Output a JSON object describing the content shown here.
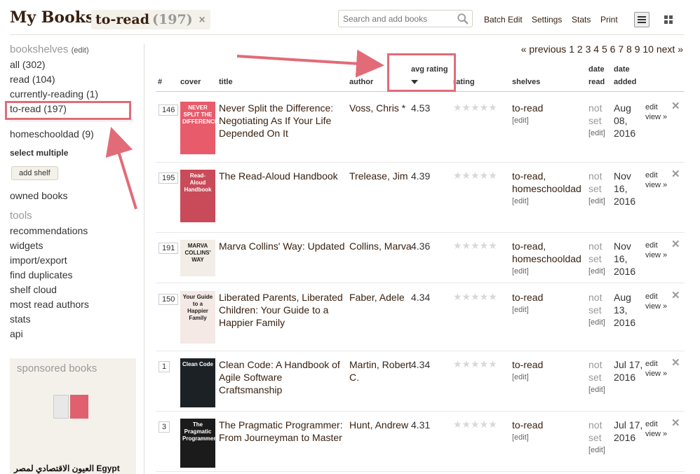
{
  "header": {
    "title": "My Books:",
    "shelf_name": "to-read",
    "shelf_count": "(197)",
    "remove_label": "×",
    "search_placeholder": "Search and add books",
    "links": [
      "Batch Edit",
      "Settings",
      "Stats",
      "Print"
    ]
  },
  "sidebar": {
    "bookshelves_heading": "bookshelves",
    "edit_link": "(edit)",
    "shelves": [
      "all (302)",
      "read (104)",
      "currently-reading (1)",
      "to-read (197)"
    ],
    "custom_shelves": [
      "homeschooldad (9)"
    ],
    "select_multiple": "select multiple",
    "add_shelf": "add shelf",
    "owned_books": "owned books",
    "tools_heading": "tools",
    "tools": [
      "recommendations",
      "widgets",
      "import/export",
      "find duplicates",
      "shelf cloud",
      "most read authors",
      "stats",
      "api"
    ],
    "sponsored_heading": "sponsored books",
    "sponsored_text": "العيون الاقتصادي لمصر Egypt"
  },
  "pagination": {
    "previous": "« previous",
    "pages": [
      "1",
      "2",
      "3",
      "4",
      "5",
      "6",
      "7",
      "8",
      "9",
      "10"
    ],
    "next": "next »"
  },
  "columns": {
    "num": "#",
    "cover": "cover",
    "title": "title",
    "author": "author",
    "avg_rating": "avg rating",
    "rating": "rating",
    "shelves": "shelves",
    "date_read_1": "date",
    "date_read_2": "read",
    "date_added_1": "date",
    "date_added_2": "added"
  },
  "row_labels": {
    "edit": "[edit]",
    "not": "not",
    "set": "set",
    "action_edit": "edit",
    "action_view": "view »",
    "delete": "✕",
    "stars": "★★★★★"
  },
  "books": [
    {
      "num": "146",
      "title": "Never Split the Difference: Negotiating As If Your Life Depended On It",
      "author": "Voss, Chris *",
      "avg": "4.53",
      "shelves": "to-read",
      "shelves2": "",
      "added1": "Aug",
      "added2": "08,",
      "added3": "2016",
      "cover_bg": "#e85b6b",
      "cover_text": "NEVER SPLIT THE DIFFERENCE"
    },
    {
      "num": "195",
      "title": "The Read-Aloud Handbook",
      "author": "Trelease, Jim",
      "avg": "4.39",
      "shelves": "to-read,",
      "shelves2": "homeschooldad",
      "added1": "Nov",
      "added2": "16,",
      "added3": "2016",
      "cover_bg": "#c94a58",
      "cover_text": "Read-Aloud Handbook"
    },
    {
      "num": "191",
      "title": "Marva Collins' Way: Updated",
      "author": "Collins, Marva",
      "avg": "4.36",
      "shelves": "to-read,",
      "shelves2": "homeschooldad",
      "added1": "Nov",
      "added2": "16,",
      "added3": "2016",
      "cover_bg": "#f2ede6",
      "cover_text": "MARVA COLLINS' WAY"
    },
    {
      "num": "150",
      "title": "Liberated Parents, Liberated Children: Your Guide to a Happier Family",
      "author": "Faber, Adele",
      "avg": "4.34",
      "shelves": "to-read",
      "shelves2": "",
      "added1": "Aug",
      "added2": "13,",
      "added3": "2016",
      "cover_bg": "#f4e9e4",
      "cover_text": "Your Guide to a Happier Family"
    },
    {
      "num": "1",
      "title": "Clean Code: A Handbook of Agile Software Craftsmanship",
      "author": "Martin, Robert C.",
      "avg": "4.34",
      "shelves": "to-read",
      "shelves2": "",
      "added1": "Jul 17,",
      "added2": "2016",
      "added3": "",
      "cover_bg": "#1c2126",
      "cover_text": "Clean Code"
    },
    {
      "num": "3",
      "title": "The Pragmatic Programmer: From Journeyman to Master",
      "author": "Hunt, Andrew",
      "avg": "4.31",
      "shelves": "to-read",
      "shelves2": "",
      "added1": "Jul 17,",
      "added2": "2016",
      "added3": "",
      "cover_bg": "#1b1b1b",
      "cover_text": "The Pragmatic Programmer"
    }
  ],
  "colors": {
    "annotation": "#e26b78",
    "brand_brown": "#382110",
    "tag_bg": "#f4f1ea"
  }
}
